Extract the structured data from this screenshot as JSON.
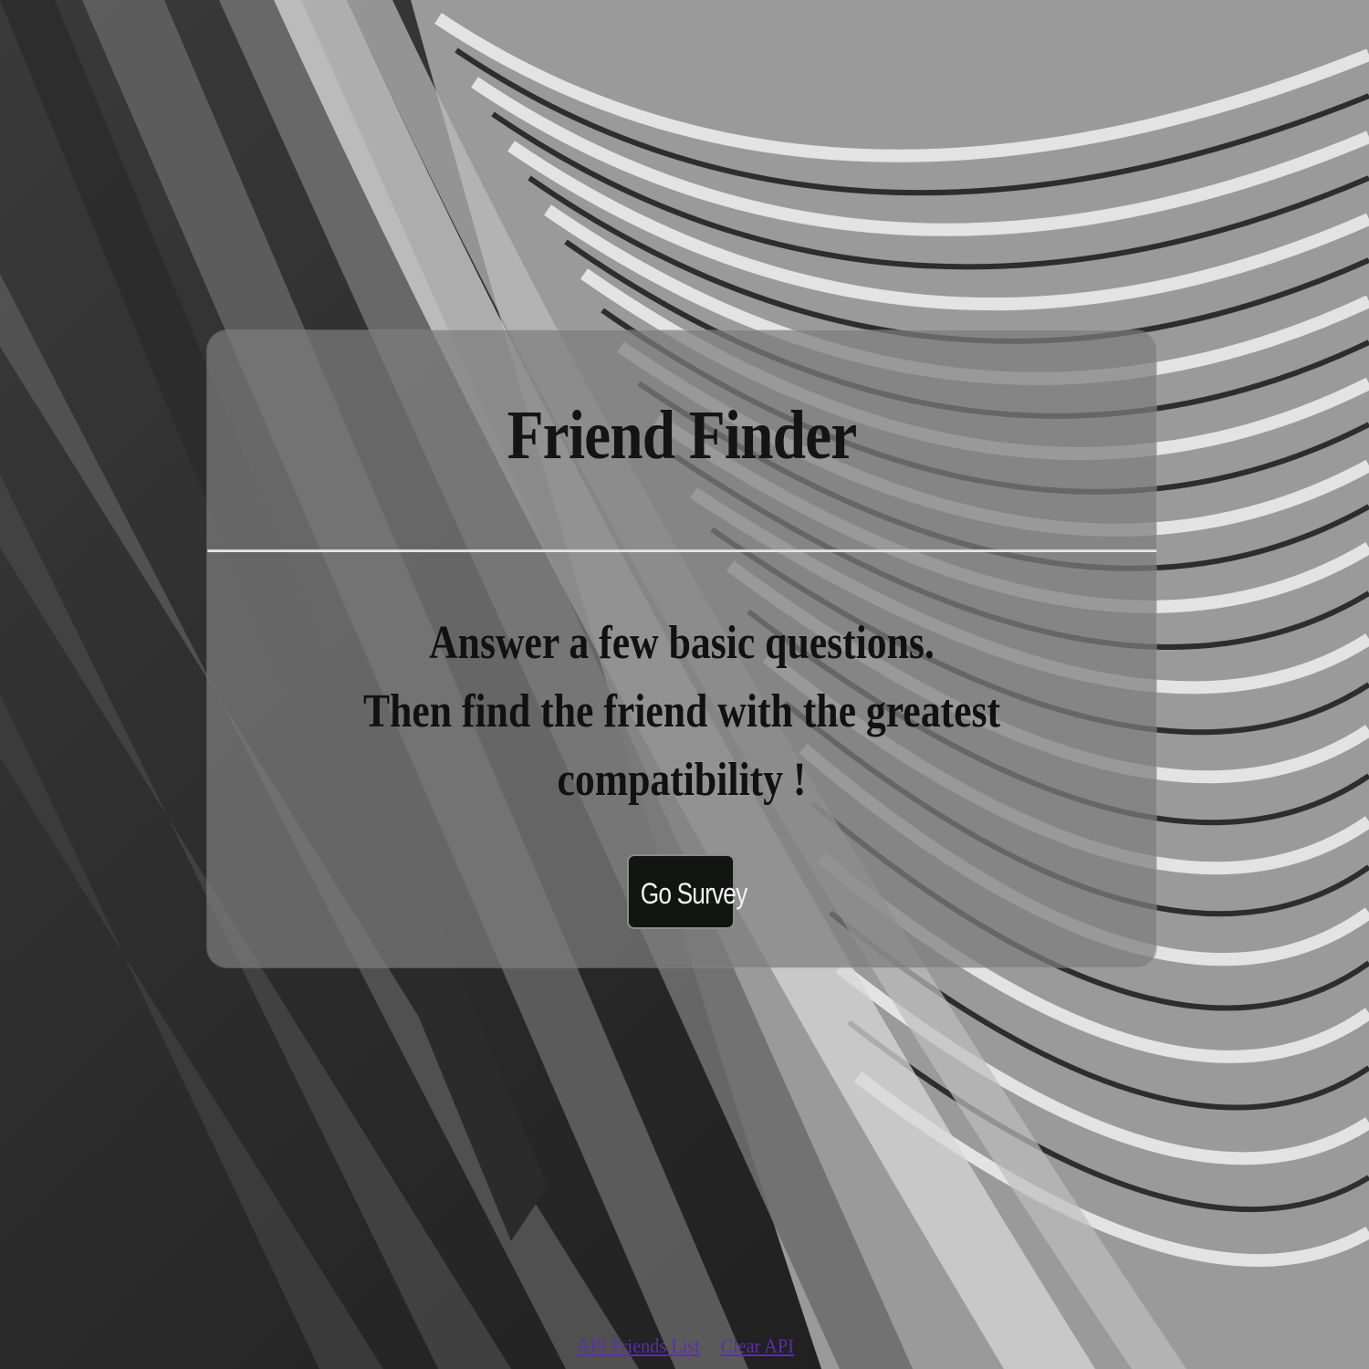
{
  "page": {
    "title": "Friend Finder",
    "lead_lines": [
      "Answer a few basic questions.",
      "Then find the friend with the greatest compatibility !"
    ],
    "primary_button_label": "Go Survey"
  },
  "footer": {
    "links": [
      {
        "label": "API Friends List"
      },
      {
        "label": "Clear API"
      }
    ]
  },
  "colors": {
    "panel": "#7d7d7d",
    "button_bg": "#121512",
    "link": "#5b2fa8"
  }
}
